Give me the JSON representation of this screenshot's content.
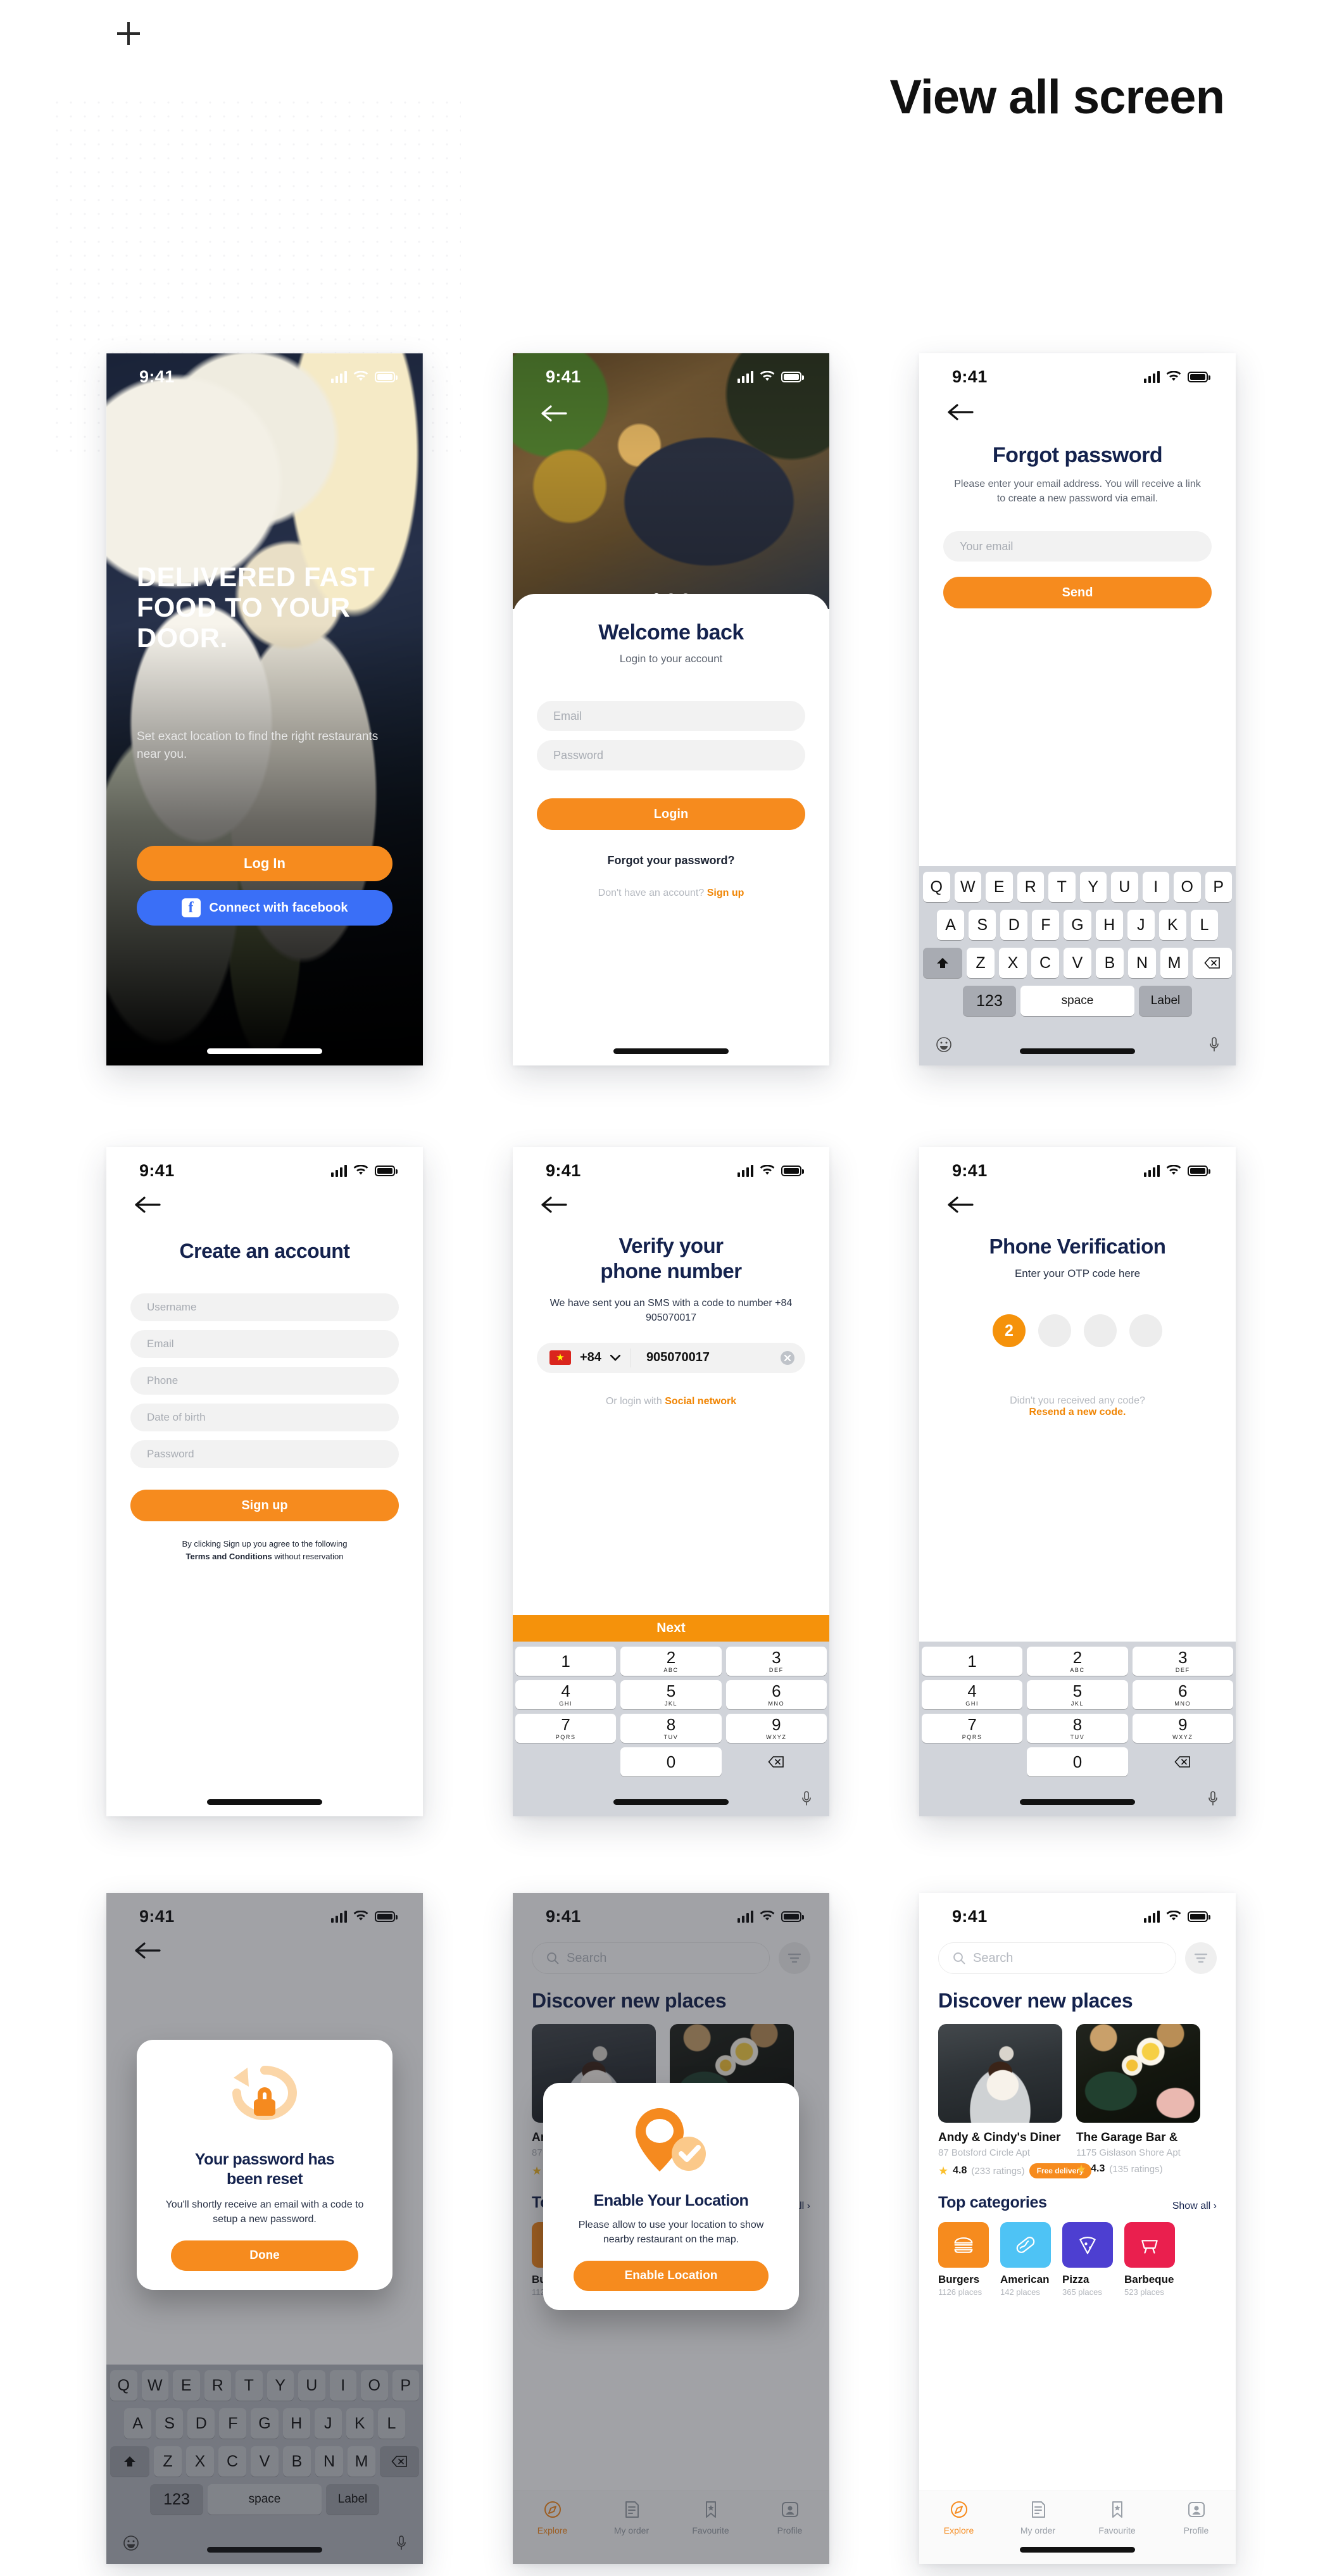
{
  "page": {
    "title": "View all screen",
    "add_icon": "plus-icon"
  },
  "status_bar": {
    "time": "9:41",
    "signal_icon": "cellular-bars-icon",
    "wifi_icon": "wifi-icon",
    "battery_icon": "battery-icon"
  },
  "screens": {
    "onboarding": {
      "headline": "DELIVERED FAST FOOD TO YOUR DOOR.",
      "sub": "Set exact location to find the right restaurants near you.",
      "login_btn": "Log In",
      "facebook_btn": "Connect with facebook",
      "facebook_glyph": "f"
    },
    "welcome": {
      "title": "Welcome back",
      "sub": "Login to your account",
      "email_placeholder": "Email",
      "password_placeholder": "Password",
      "login_btn": "Login",
      "forgot": "Forgot your password?",
      "signup_prefix": "Don't have an account? ",
      "signup_link": "Sign up"
    },
    "forgot": {
      "title": "Forgot password",
      "sub": "Please enter your email address. You will receive a link to create a new password via email.",
      "email_placeholder": "Your email",
      "send_btn": "Send"
    },
    "create_account": {
      "title": "Create an account",
      "fields": [
        "Username",
        "Email",
        "Phone",
        "Date of birth",
        "Password"
      ],
      "signup_btn": "Sign up",
      "terms_line1": "By clicking Sign up you agree to the following",
      "terms_bold": "Terms and Conditions",
      "terms_line2": " without reservation"
    },
    "verify_phone": {
      "title_line1": "Verify your",
      "title_line2": "phone number",
      "sub": "We have sent you an SMS with a code to number +84 905070017",
      "country_code": "+84",
      "phone_value": "905070017",
      "clear_icon": "clear-input-icon",
      "social_prefix": "Or login with ",
      "social_link": "Social network",
      "next_btn": "Next"
    },
    "phone_verification": {
      "title": "Phone Verification",
      "sub": "Enter your OTP code here",
      "otp_value": "2",
      "otp_slots": 4,
      "resend_q": "Didn't you received any code?",
      "resend_link": "Resend a new code."
    },
    "password_reset": {
      "icon": "lock-reset-icon",
      "title_line1": "Your password has",
      "title_line2": "been reset",
      "sub": "You'll shortly receive an email with a code to setup a new password.",
      "done_btn": "Done"
    },
    "enable_location": {
      "icon": "location-pin-check-icon",
      "title": "Enable Your Location",
      "sub": "Please allow to use your location to show nearby restaurant on the map.",
      "enable_btn": "Enable Location"
    },
    "discover": {
      "search_placeholder": "Search",
      "search_icon": "search-icon",
      "filter_icon": "filter-icon",
      "heading": "Discover new places",
      "cards": [
        {
          "name": "Andy & Cindy's Diner",
          "address": "87 Botsford Circle Apt",
          "rating": "4.8",
          "ratings": "(233 ratings)",
          "badge": "Free delivery"
        },
        {
          "name": "The Garage Bar & ",
          "address": "1175 Gislason Shore Apt",
          "rating": "4.3",
          "ratings": "(135 ratings)",
          "badge": ""
        }
      ],
      "cat_heading": "Top categories",
      "show_all": "Show all",
      "show_all_icon": "chevron-right-icon",
      "categories": [
        {
          "label": "Burgers",
          "places": "1126 places",
          "color": "#f68b1e",
          "icon": "burger-icon"
        },
        {
          "label": "American",
          "places": "142 places",
          "color": "#4ec3f5",
          "icon": "hotdog-icon"
        },
        {
          "label": "Pizza",
          "places": "365 places",
          "color": "#4d3fd1",
          "icon": "pizza-icon"
        },
        {
          "label": "Barbeque",
          "places": "523 places",
          "color": "#ea1f4e",
          "icon": "bbq-icon"
        }
      ],
      "tabs": [
        {
          "label": "Explore",
          "icon": "compass-icon",
          "active": true
        },
        {
          "label": "My order",
          "icon": "receipt-icon",
          "active": false
        },
        {
          "label": "Favourite",
          "icon": "bookmark-star-icon",
          "active": false
        },
        {
          "label": "Profile",
          "icon": "person-icon",
          "active": false
        }
      ]
    }
  },
  "keyboard": {
    "row1": [
      "Q",
      "W",
      "E",
      "R",
      "T",
      "Y",
      "U",
      "I",
      "O",
      "P"
    ],
    "row2": [
      "A",
      "S",
      "D",
      "F",
      "G",
      "H",
      "J",
      "K",
      "L"
    ],
    "row3": [
      "Z",
      "X",
      "C",
      "V",
      "B",
      "N",
      "M"
    ],
    "shift_icon": "shift-icon",
    "backspace_icon": "backspace-icon",
    "num_key": "123",
    "space_key": "space",
    "label_key": "Label",
    "emoji_icon": "emoji-icon",
    "mic_icon": "microphone-icon"
  },
  "numpad": {
    "keys": [
      {
        "d": "1",
        "s": ""
      },
      {
        "d": "2",
        "s": "ABC"
      },
      {
        "d": "3",
        "s": "DEF"
      },
      {
        "d": "4",
        "s": "GHI"
      },
      {
        "d": "5",
        "s": "JKL"
      },
      {
        "d": "6",
        "s": "MNO"
      },
      {
        "d": "7",
        "s": "PQRS"
      },
      {
        "d": "8",
        "s": "TUV"
      },
      {
        "d": "9",
        "s": "WXYZ"
      },
      {
        "d": "0",
        "s": ""
      }
    ],
    "backspace_icon": "backspace-icon",
    "mic_icon": "microphone-icon"
  },
  "colors": {
    "orange": "#f68b1e",
    "navy": "#14224d",
    "facebook_blue": "#3a6ff7"
  }
}
